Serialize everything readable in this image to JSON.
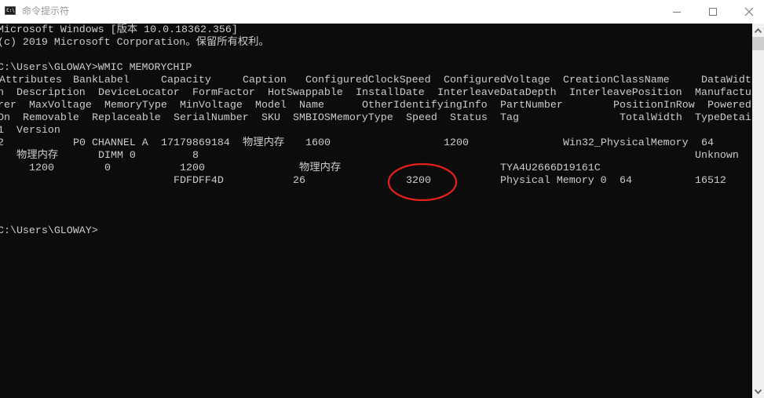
{
  "window": {
    "title": "命令提示符",
    "icon": "cmd-icon",
    "icon_text": "C:\\.",
    "controls": {
      "minimize": "minimize-icon",
      "maximize": "maximize-icon",
      "close": "close-icon"
    }
  },
  "terminal": {
    "banner_line1": "Microsoft Windows [版本 10.0.18362.356]",
    "banner_line2": "(c) 2019 Microsoft Corporation。保留所有权利。",
    "prompt1": "C:\\Users\\GLOWAY>WMIC MEMORYCHIP",
    "header_rows": [
      [
        "Attributes",
        "BankLabel",
        "Capacity",
        "Caption",
        "ConfiguredClockSpeed",
        "ConfiguredVoltage",
        "CreationClassName",
        "DataWidt"
      ],
      [
        "n",
        "Description",
        "DeviceLocator",
        "FormFactor",
        "HotSwappable",
        "InstallDate",
        "InterleaveDataDepth",
        "InterleavePosition",
        "Manufactu"
      ],
      [
        "rer",
        "MaxVoltage",
        "MemoryType",
        "MinVoltage",
        "Model",
        "Name",
        "OtherIdentifyingInfo",
        "PartNumber",
        "PositionInRow",
        "Powered"
      ],
      [
        "On",
        "Removable",
        "Replaceable",
        "SerialNumber",
        "SKU",
        "SMBIOSMemoryType",
        "Speed",
        "Status",
        "Tag",
        "TotalWidth",
        "TypeDetai"
      ],
      [
        "1",
        "Version"
      ]
    ],
    "data_rows": [
      [
        "2",
        "P0 CHANNEL A",
        "17179869184",
        "物理内存",
        "1600",
        "1200",
        "Win32_PhysicalMemory",
        "64"
      ],
      [
        "物理内存",
        "DIMM 0",
        "8",
        "Unknown"
      ],
      [
        "1200",
        "0",
        "1200",
        "物理内存",
        "TYA4U2666D19161C"
      ],
      [
        "FDFDFF4D",
        "26",
        "3200",
        "Physical Memory 0",
        "64",
        "16512"
      ]
    ],
    "prompt2": "C:\\Users\\GLOWAY>"
  },
  "annotation": {
    "highlighted_value": "3200",
    "color": "#e8201a"
  },
  "colors": {
    "terminal_bg": "#0c0c0c",
    "terminal_fg": "#cccccc",
    "titlebar_bg": "#ffffff",
    "scrollbar_bg": "#f0f0f0",
    "scrollbar_thumb": "#cdcdcd"
  }
}
